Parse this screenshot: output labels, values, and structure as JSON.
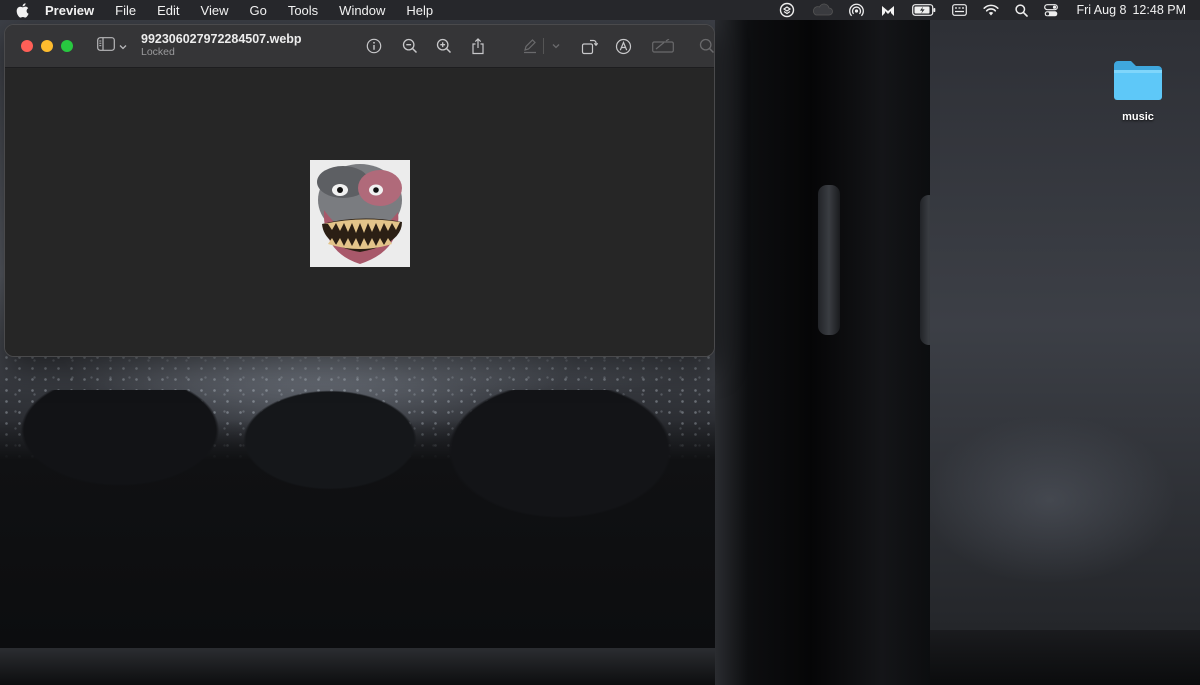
{
  "menubar": {
    "app_name": "Preview",
    "items": [
      "File",
      "Edit",
      "View",
      "Go",
      "Tools",
      "Window",
      "Help"
    ],
    "status_icons": [
      "dropbox-icon",
      "cloud-icon",
      "airdrop-icon",
      "malwarebytes-icon",
      "battery-icon",
      "keyboard-input-icon",
      "wifi-icon",
      "spotlight-search-icon",
      "control-center-icon"
    ],
    "date": "Fri Aug 8",
    "time": "12:48 PM"
  },
  "preview_window": {
    "title": "992306027972284507.webp",
    "subtitle": "Locked",
    "toolbar": [
      "info-icon",
      "zoom-out-icon",
      "zoom-in-icon",
      "share-icon",
      "highlight-pen-icon",
      "highlight-menu-chevron-icon",
      "rotate-icon",
      "markup-icon",
      "edit-form-icon",
      "search-icon"
    ],
    "image_description_icon": "image-thumbnail-icon"
  },
  "desktop": {
    "folder_label": "music",
    "folder_color": "#5ec8f8"
  },
  "colors": {
    "traffic_red": "#ff5f57",
    "traffic_yellow": "#febc2e",
    "traffic_green": "#28c840",
    "menubar_bg": "#26272b"
  }
}
